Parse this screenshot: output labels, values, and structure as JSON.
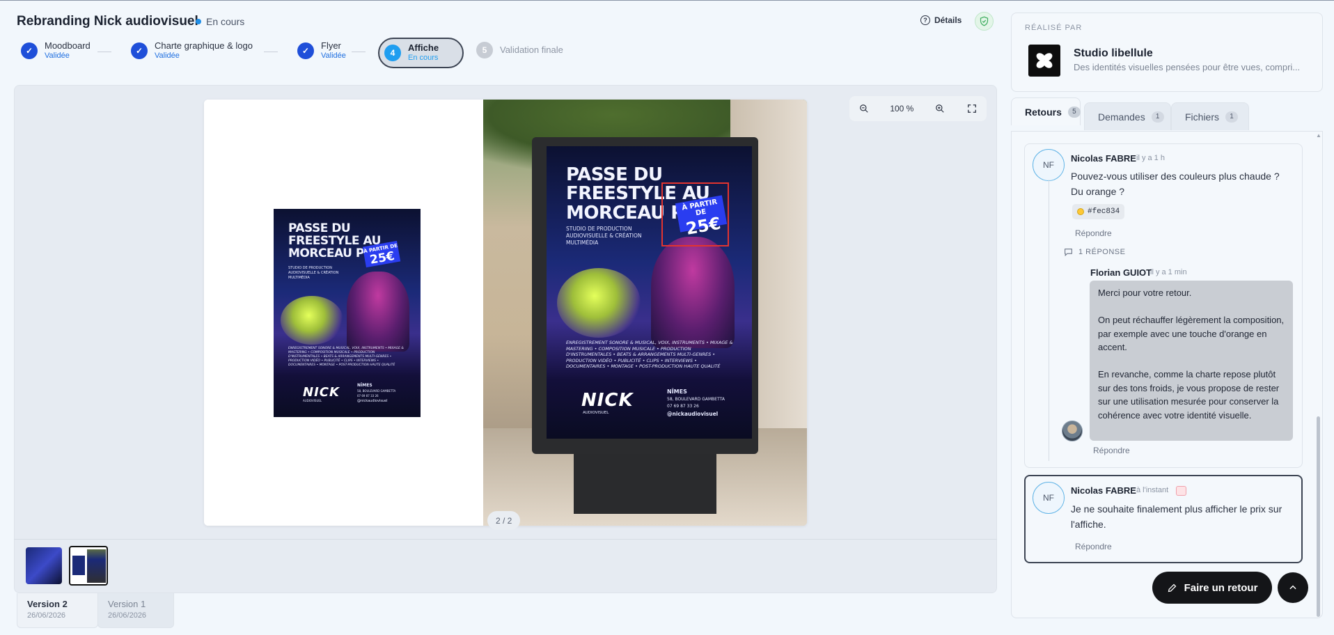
{
  "project": {
    "title": "Rebranding Nick audiovisuel",
    "status": "En cours"
  },
  "header": {
    "details_label": "Détails"
  },
  "steps": [
    {
      "num": "1",
      "label": "Moodboard",
      "status": "Validée"
    },
    {
      "num": "2",
      "label": "Charte graphique & logo",
      "status": "Validée"
    },
    {
      "num": "3",
      "label": "Flyer",
      "status": "Validée"
    },
    {
      "num": "4",
      "label": "Affiche",
      "status": "En cours"
    },
    {
      "num": "5",
      "label": "Validation finale",
      "status": ""
    }
  ],
  "viewer": {
    "zoom": "100 %",
    "page_indicator": "2 / 2",
    "poster": {
      "headline": "PASSE DU FREESTYLE AU MORCEAU PRO.",
      "price_prefix": "À PARTIR DE",
      "price": "25€",
      "subtitle": "STUDIO DE PRODUCTION AUDIOVISUELLE & CRÉATION MULTIMÉDIA",
      "services": "ENREGISTREMENT SONORE & MUSICAL, VOIX, INSTRUMENTS • MIXAGE & MASTERING • COMPOSITION MUSICALE • PRODUCTION D'INSTRUMENTALES • BEATS & ARRANGEMENTS MULTI-GENRES • PRODUCTION VIDÉO • PUBLICITÉ • CLIPS • INTERVIEWS • DOCUMENTAIRES • MONTAGE • POST-PRODUCTION HAUTE QUALITÉ",
      "brand": "NICK",
      "brand_sub": "AUDIOVISUEL",
      "city": "NÎMES",
      "address": "58, BOULEVARD GAMBETTA",
      "phone": "07 69 87 33 26",
      "handle": "@nickaudiovisuel"
    }
  },
  "versions": [
    {
      "name": "Version 2",
      "date": "26/06/2026"
    },
    {
      "name": "Version 1",
      "date": "26/06/2026"
    }
  ],
  "studio": {
    "realise_par": "RÉALISÉ PAR",
    "name": "Studio libellule",
    "description": "Des identités visuelles pensées pour être vues, compri..."
  },
  "tabs": [
    {
      "label": "Retours",
      "count": "5"
    },
    {
      "label": "Demandes",
      "count": "1"
    },
    {
      "label": "Fichiers",
      "count": "1"
    }
  ],
  "comments": {
    "first": {
      "initials": "NF",
      "author": "Nicolas FABRE",
      "time": "il y a 1 h",
      "text": "Pouvez-vous utiliser des couleurs plus chaude ? Du orange ?",
      "color_tag": "#fec834",
      "reply_label": "Répondre",
      "reply_count": "1 RÉPONSE",
      "reply": {
        "author": "Florian GUIOT",
        "time": "il y a 1 min",
        "text": "Merci pour votre retour.\n\nOn peut réchauffer légèrement la composition, par exemple avec une touche d'orange en accent.\n\nEn revanche, comme la charte repose plutôt sur des tons froids, je vous propose de rester sur une utilisation mesurée pour conserver la cohérence avec votre identité visuelle.",
        "reply_label": "Répondre"
      }
    },
    "second": {
      "initials": "NF",
      "author": "Nicolas FABRE",
      "time": "à l'instant",
      "text": "Je ne souhaite finalement plus afficher le prix sur l'affiche.",
      "reply_label": "Répondre"
    }
  },
  "actions": {
    "feedback_button": "Faire un retour"
  }
}
